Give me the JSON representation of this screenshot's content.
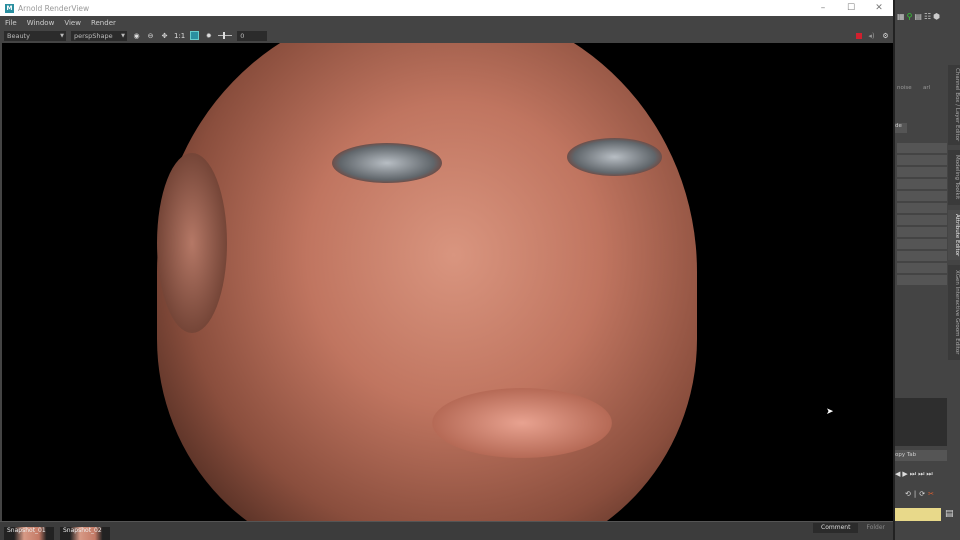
{
  "window": {
    "title": "Arnold RenderView",
    "app_icon": "M",
    "min": "–",
    "max": "☐",
    "close": "✕"
  },
  "menu": [
    "File",
    "Window",
    "View",
    "Render"
  ],
  "toolbar": {
    "aov": "Beauty",
    "camera": "perspShape",
    "ratio": "1:1",
    "exposure": "0"
  },
  "bottom": {
    "snapshots": [
      "Snapshot_01",
      "Snapshot_02"
    ],
    "tabs": [
      "Comment",
      "Folder"
    ]
  },
  "right_panel": {
    "vertical_tabs": [
      "Channel Box / Layer Editor",
      "Modeling Toolkit",
      "Attribute Editor",
      "XGen Interactive Groom Editor"
    ],
    "field1": "noise",
    "field2": "arl",
    "button": "de",
    "copy_tab": "opy Tab"
  },
  "colors": {
    "record": "#d0202e",
    "time_field": "#e8d98a"
  }
}
